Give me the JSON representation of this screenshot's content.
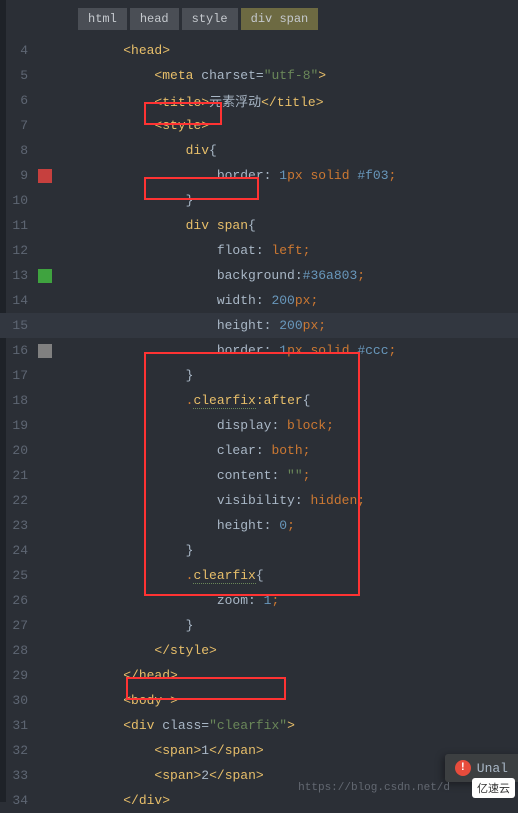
{
  "breadcrumb": [
    "html",
    "head",
    "style",
    "div span"
  ],
  "lines": [
    {
      "n": 4,
      "marker": "",
      "html": "<span class='tag-bracket'>&lt;</span><span class='tag-name'>head</span><span class='tag-bracket'>&gt;</span>",
      "indent": 1
    },
    {
      "n": 5,
      "marker": "",
      "html": "<span class='tag-bracket'>&lt;</span><span class='tag-name'>meta</span> <span class='attr-name'>charset</span>=<span class='attr-value'>\"utf-8\"</span><span class='tag-bracket'>&gt;</span>",
      "indent": 2
    },
    {
      "n": 6,
      "marker": "",
      "html": "<span class='tag-bracket'>&lt;</span><span class='tag-name'>title</span><span class='tag-bracket'>&gt;</span><span class='text'>元素浮动</span><span class='tag-bracket'>&lt;/</span><span class='tag-name'>title</span><span class='tag-bracket'>&gt;</span>",
      "indent": 2
    },
    {
      "n": 7,
      "marker": "",
      "html": "<span class='tag-bracket'>&lt;</span><span class='tag-name'>style</span><span class='tag-bracket'>&gt;</span>",
      "indent": 2
    },
    {
      "n": 8,
      "marker": "",
      "html": "<span class='selector'>div</span><span class='brace'>{</span>",
      "indent": 3
    },
    {
      "n": 9,
      "marker": "red",
      "html": "<span class='property'>border</span>: <span class='number'>1</span><span class='unit'>px</span> <span class='value'>solid</span> <span class='color-val'>#f03</span><span class='semicolon'>;</span>",
      "indent": 4
    },
    {
      "n": 10,
      "marker": "",
      "html": "<span class='brace'>}</span>",
      "indent": 3
    },
    {
      "n": 11,
      "marker": "",
      "html": "<span class='selector'>div span</span><span class='brace'>{</span>",
      "indent": 3
    },
    {
      "n": 12,
      "marker": "",
      "html": "<span class='property'>float</span>: <span class='value'>left</span><span class='semicolon'>;</span>",
      "indent": 4
    },
    {
      "n": 13,
      "marker": "green",
      "html": "<span class='property'>background</span>:<span class='color-val'>#36a803</span><span class='semicolon'>;</span>",
      "indent": 4
    },
    {
      "n": 14,
      "marker": "",
      "html": "<span class='property'>width</span>: <span class='number'>200</span><span class='unit'>px</span><span class='semicolon'>;</span>",
      "indent": 4
    },
    {
      "n": 15,
      "marker": "",
      "html": "<span class='property'>height</span>: <span class='number'>200</span><span class='unit'>px</span><span class='semicolon'>;</span>",
      "indent": 4,
      "hl": true
    },
    {
      "n": 16,
      "marker": "gray",
      "html": "<span class='property'>border</span>: <span class='number'>1</span><span class='unit'>px</span> <span class='value'>solid</span> <span class='color-val'>#ccc</span><span class='semicolon'>;</span>",
      "indent": 4
    },
    {
      "n": 17,
      "marker": "",
      "html": "<span class='brace'>}</span>",
      "indent": 3
    },
    {
      "n": 18,
      "marker": "",
      "html": "<span class='punct'>.</span><span class='class-sel underline'>clearfix</span><span class='pseudo'>:after</span><span class='brace'>{</span>",
      "indent": 3
    },
    {
      "n": 19,
      "marker": "",
      "html": "<span class='property'>display</span>: <span class='value'>block</span><span class='semicolon'>;</span>",
      "indent": 4
    },
    {
      "n": 20,
      "marker": "",
      "html": "<span class='property'>clear</span>: <span class='value'>both</span><span class='semicolon'>;</span>",
      "indent": 4
    },
    {
      "n": 21,
      "marker": "",
      "html": "<span class='property'>content</span>: <span class='string'>\"\"</span><span class='semicolon'>;</span>",
      "indent": 4
    },
    {
      "n": 22,
      "marker": "",
      "html": "<span class='property'>visibility</span>: <span class='value'>hidden</span><span class='semicolon'>;</span>",
      "indent": 4
    },
    {
      "n": 23,
      "marker": "",
      "html": "<span class='property'>height</span>: <span class='number'>0</span><span class='semicolon'>;</span>",
      "indent": 4
    },
    {
      "n": 24,
      "marker": "",
      "html": "<span class='brace'>}</span>",
      "indent": 3
    },
    {
      "n": 25,
      "marker": "",
      "html": "<span class='punct'>.</span><span class='class-sel underline'>clearfix</span><span class='brace'>{</span>",
      "indent": 3
    },
    {
      "n": 26,
      "marker": "",
      "html": "<span class='property'>zoom</span>: <span class='number'>1</span><span class='semicolon'>;</span>",
      "indent": 4
    },
    {
      "n": 27,
      "marker": "",
      "html": "<span class='brace'>}</span>",
      "indent": 3
    },
    {
      "n": 28,
      "marker": "",
      "html": "<span class='tag-bracket'>&lt;/</span><span class='tag-name'>style</span><span class='tag-bracket'>&gt;</span>",
      "indent": 2
    },
    {
      "n": 29,
      "marker": "",
      "html": "<span class='tag-bracket'>&lt;/</span><span class='tag-name'>head</span><span class='tag-bracket'>&gt;</span>",
      "indent": 1
    },
    {
      "n": 30,
      "marker": "",
      "html": "<span class='tag-bracket'>&lt;</span><span class='tag-name'>body</span> <span class='tag-bracket'>&gt;</span>",
      "indent": 1
    },
    {
      "n": 31,
      "marker": "",
      "html": "<span class='tag-bracket'>&lt;</span><span class='tag-name'>div</span> <span class='attr-name'>class</span>=<span class='attr-value'>\"clearfix\"</span><span class='tag-bracket'>&gt;</span>",
      "indent": 1
    },
    {
      "n": 32,
      "marker": "",
      "html": "<span class='tag-bracket'>&lt;</span><span class='tag-name'>span</span><span class='tag-bracket'>&gt;</span><span class='text'>1</span><span class='tag-bracket'>&lt;/</span><span class='tag-name'>span</span><span class='tag-bracket'>&gt;</span>",
      "indent": 2
    },
    {
      "n": 33,
      "marker": "",
      "html": "<span class='tag-bracket'>&lt;</span><span class='tag-name'>span</span><span class='tag-bracket'>&gt;</span><span class='text'>2</span><span class='tag-bracket'>&lt;/</span><span class='tag-name'>span</span><span class='tag-bracket'>&gt;</span>",
      "indent": 2
    },
    {
      "n": 34,
      "marker": "",
      "html": "<span class='tag-bracket'>&lt;/</span><span class='tag-name'>div</span><span class='tag-bracket'>&gt;</span>",
      "indent": 1
    }
  ],
  "notification": {
    "text": "Unal"
  },
  "watermark": "https://blog.csdn.net/d",
  "logo": "亿速云"
}
